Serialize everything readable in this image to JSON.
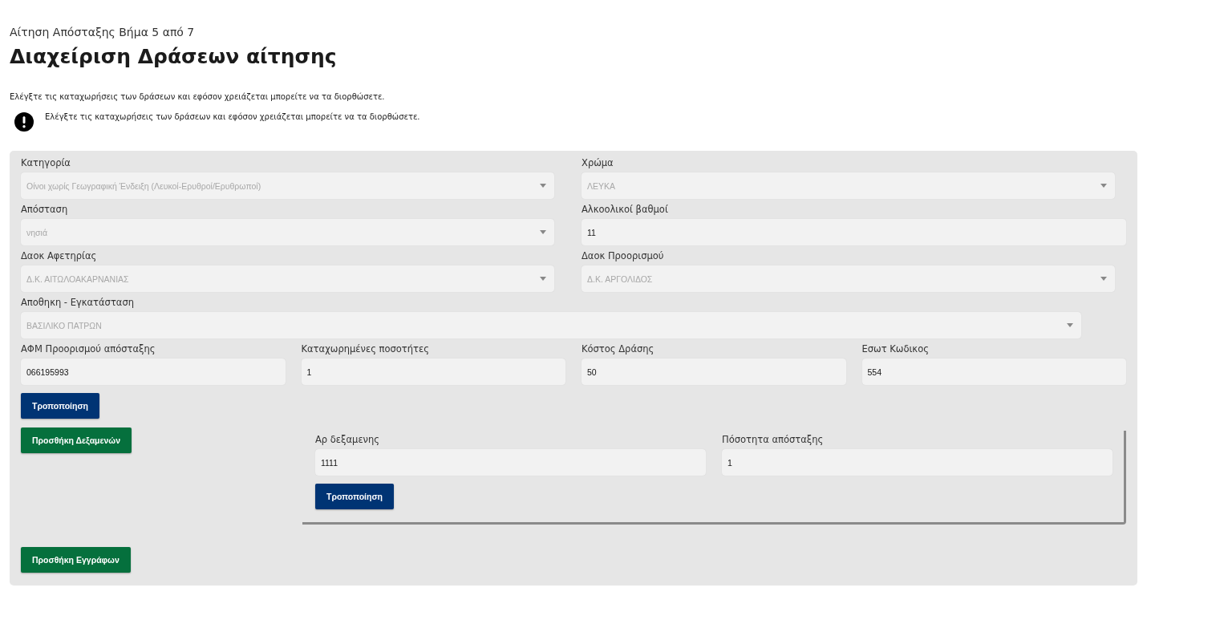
{
  "breadcrumb": "Αίτηση Απόσταξης Βήμα 5 από 7",
  "title": "Διαχείριση Δράσεων αίτησης",
  "intro": "Ελέγξτε τις καταχωρήσεις των δράσεων και εφόσον χρειάζεται μπορείτε να τα διορθώσετε.",
  "alert": {
    "text": "Ελέγξτε τις καταχωρήσεις των δράσεων και εφόσον χρειάζεται μπορείτε να τα διορθώσετε."
  },
  "form": {
    "rows": [
      [
        {
          "label": "Κατηγορία",
          "value": "Οίνοι χωρίς Γεωγραφική Ένδειξη (Λευκοί-Ερυθροί/Ερυθρωποί)",
          "kind": "select"
        },
        {
          "label": "Χρώμα",
          "value": "ΛΕΥΚΑ",
          "kind": "select"
        }
      ],
      [
        {
          "label": "Απόσταση",
          "value": "νησιά",
          "kind": "select"
        },
        {
          "label": "Αλκοολικοί βαθμοί",
          "value": "11",
          "kind": "input"
        }
      ],
      [
        {
          "label": "Δαοκ Αφετηρίας",
          "value": "Δ.Κ. ΑΙΤΩΛΟΑΚΑΡΝΑΝΙΑΣ",
          "kind": "select"
        },
        {
          "label": "Δαοκ Προορισμού",
          "value": "Δ.Κ. ΑΡΓΟΛΙΔΟΣ",
          "kind": "select"
        }
      ],
      [
        {
          "label": "Αποθηκη - Εγκατάσταση",
          "value": "ΒΑΣΙΛΙΚΟ ΠΑΤΡΩΝ",
          "kind": "select"
        }
      ],
      [
        {
          "label": "ΑΦΜ Προορισμού απόσταξης",
          "value": "066195993",
          "kind": "input"
        },
        {
          "label": "Καταχωρημένες ποσοτήτες",
          "value": "1",
          "kind": "input"
        },
        {
          "label": "Κόστος Δράσης",
          "value": "50",
          "kind": "input"
        },
        {
          "label": "Εσωτ Κωδικος",
          "value": "554",
          "kind": "input"
        }
      ]
    ],
    "edit_button": "Τροποποίηση",
    "add_tanks_button": "Προσθήκη Δεξαμενών",
    "tanks": [
      {
        "fields": [
          {
            "label": "Αρ δεξαμενης",
            "value": "1111",
            "kind": "input"
          },
          {
            "label": "Πόσοτητα απόσταξης",
            "value": "1",
            "kind": "input"
          }
        ],
        "edit_button": "Τροποποίηση"
      }
    ],
    "add_documents_button": "Προσθήκη Εγγράφων"
  }
}
